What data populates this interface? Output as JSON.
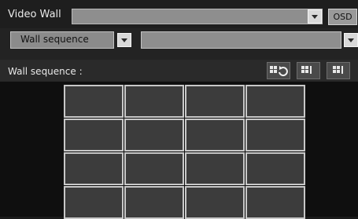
{
  "header": {
    "video_wall_label": "Video Wall",
    "video_wall_value": "",
    "osd_label": "OSD"
  },
  "sequence": {
    "selected": "Wall sequence",
    "secondary_value": ""
  },
  "panel": {
    "title": "Wall sequence :"
  },
  "toolbar": {
    "buttons": [
      "layout-rotate-icon",
      "layout-prev-icon",
      "layout-next-icon"
    ]
  },
  "grid": {
    "rows": 4,
    "cols": 4
  },
  "colors": {
    "background": "#1b1b1b",
    "cell_fill": "#3c3c3c",
    "cell_border": "#c8c8c8"
  }
}
